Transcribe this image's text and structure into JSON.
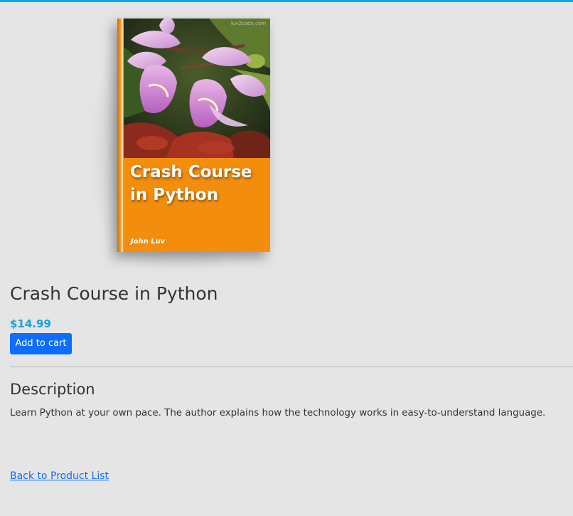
{
  "product": {
    "title": "Crash Course in Python",
    "price": "$14.99",
    "add_to_cart_label": "Add to cart"
  },
  "cover": {
    "title": "Crash Course in Python",
    "author": "John Luv",
    "watermark": "luv2code.com",
    "background_color": "#f28d0e"
  },
  "description": {
    "heading": "Description",
    "text": "Learn Python at your own pace. The author explains how the technology works in easy-to-understand language."
  },
  "navigation": {
    "back_link_label": "Back to Product List"
  },
  "colors": {
    "accent_bar": "#0fa7e6",
    "price": "#0ea6e6",
    "primary_button": "#0d6efd",
    "link": "#0d6efd"
  }
}
